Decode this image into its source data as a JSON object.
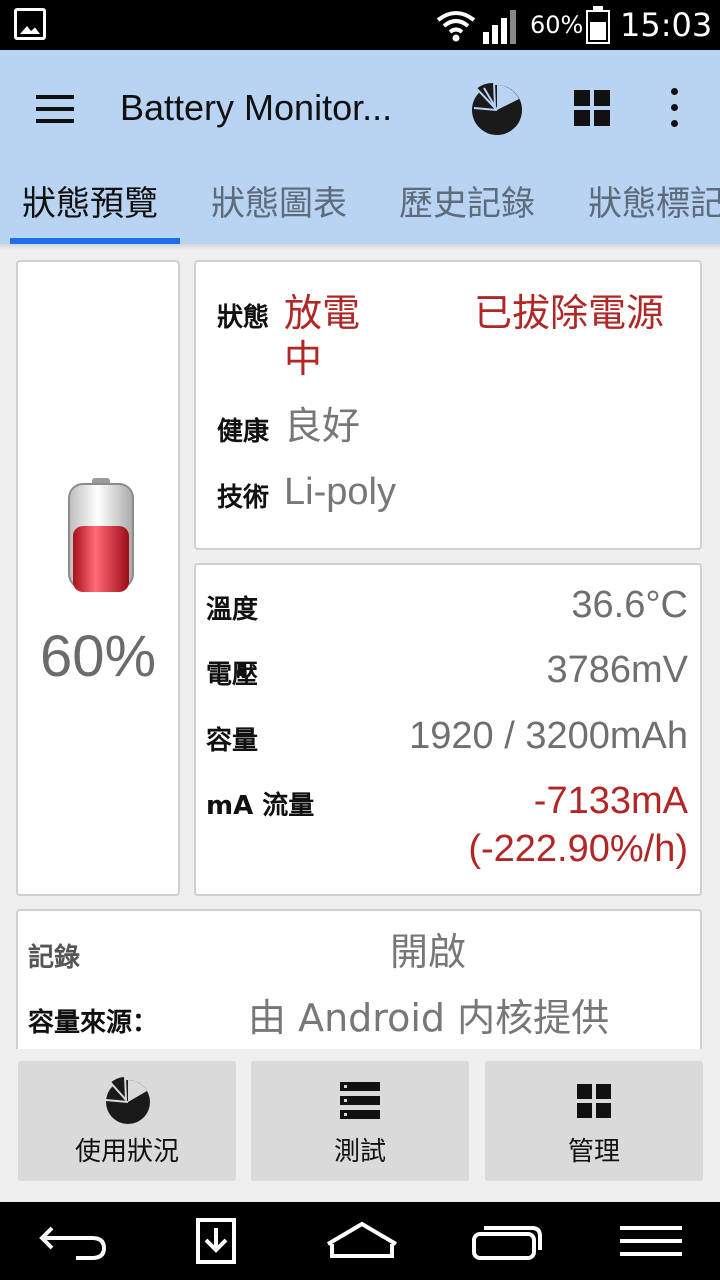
{
  "status_bar": {
    "battery_percent": "60%",
    "time": "15:03",
    "battery_level": 0.6
  },
  "app_bar": {
    "title": "Battery Monitor...",
    "icons": [
      "menu-icon",
      "pie-chart-icon",
      "grid-icon",
      "more-vert-icon"
    ]
  },
  "tabs": [
    {
      "label": "狀態預覽",
      "active": true
    },
    {
      "label": "狀態圖表",
      "active": false
    },
    {
      "label": "歷史記錄",
      "active": false
    },
    {
      "label": "狀態標記",
      "active": false
    }
  ],
  "battery": {
    "percent": "60%",
    "level": 0.6
  },
  "status": {
    "state_label": "狀態",
    "state_value": "放電\n中",
    "state_value_line1": "放電",
    "state_value_line2": "中",
    "plug_status": "已拔除電源",
    "health_label": "健康",
    "health_value": "良好",
    "tech_label": "技術",
    "tech_value": "Li-poly"
  },
  "metrics": {
    "temp_label": "溫度",
    "temp_value": "36.6°C",
    "voltage_label": "電壓",
    "voltage_value": "3786mV",
    "capacity_label": "容量",
    "capacity_value": "1920 / 3200mAh",
    "current_label": "mA 流量",
    "current_value": "-7133mA",
    "current_rate": "(-222.90%/h)"
  },
  "log": {
    "record_label": "記錄",
    "record_value": "開啟",
    "source_label": "容量來源：",
    "source_value": "由 Android 内核提供"
  },
  "actions": [
    {
      "label": "使用狀況",
      "icon": "pie-chart-icon"
    },
    {
      "label": "測試",
      "icon": "list-icon"
    },
    {
      "label": "管理",
      "icon": "grid-icon"
    }
  ],
  "colors": {
    "accent": "#1e6ee8",
    "appbar": "#b9d3f3",
    "alert_red": "#b32626"
  }
}
